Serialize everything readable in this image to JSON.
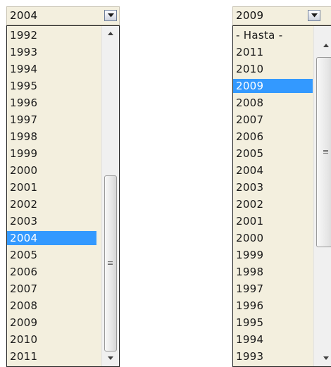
{
  "left_dropdown": {
    "selected_value": "2004",
    "options": [
      "1992",
      "1993",
      "1994",
      "1995",
      "1996",
      "1997",
      "1998",
      "1999",
      "2000",
      "2001",
      "2002",
      "2003",
      "2004",
      "2005",
      "2006",
      "2007",
      "2008",
      "2009",
      "2010",
      "2011"
    ],
    "highlighted_option": "2004",
    "icons": {
      "toggle": "chevron-down-icon",
      "scroll_up": "scroll-up-arrow-icon",
      "scroll_down": "scroll-down-arrow-icon",
      "thumb_grip": "grip-icon"
    }
  },
  "right_dropdown": {
    "selected_value": "2009",
    "options": [
      "- Hasta -",
      "2011",
      "2010",
      "2009",
      "2008",
      "2007",
      "2006",
      "2005",
      "2004",
      "2003",
      "2002",
      "2001",
      "2000",
      "1999",
      "1998",
      "1997",
      "1996",
      "1995",
      "1994",
      "1993"
    ],
    "highlighted_option": "2009",
    "icons": {
      "toggle": "chevron-down-icon",
      "scroll_up": "scroll-up-arrow-icon",
      "scroll_down": "scroll-down-arrow-icon",
      "thumb_grip": "grip-icon"
    }
  },
  "colors": {
    "dropdown_background": "#f3efde",
    "selection_highlight": "#3399ff",
    "selection_text": "#ffffff",
    "option_text": "#1a1a1a"
  }
}
